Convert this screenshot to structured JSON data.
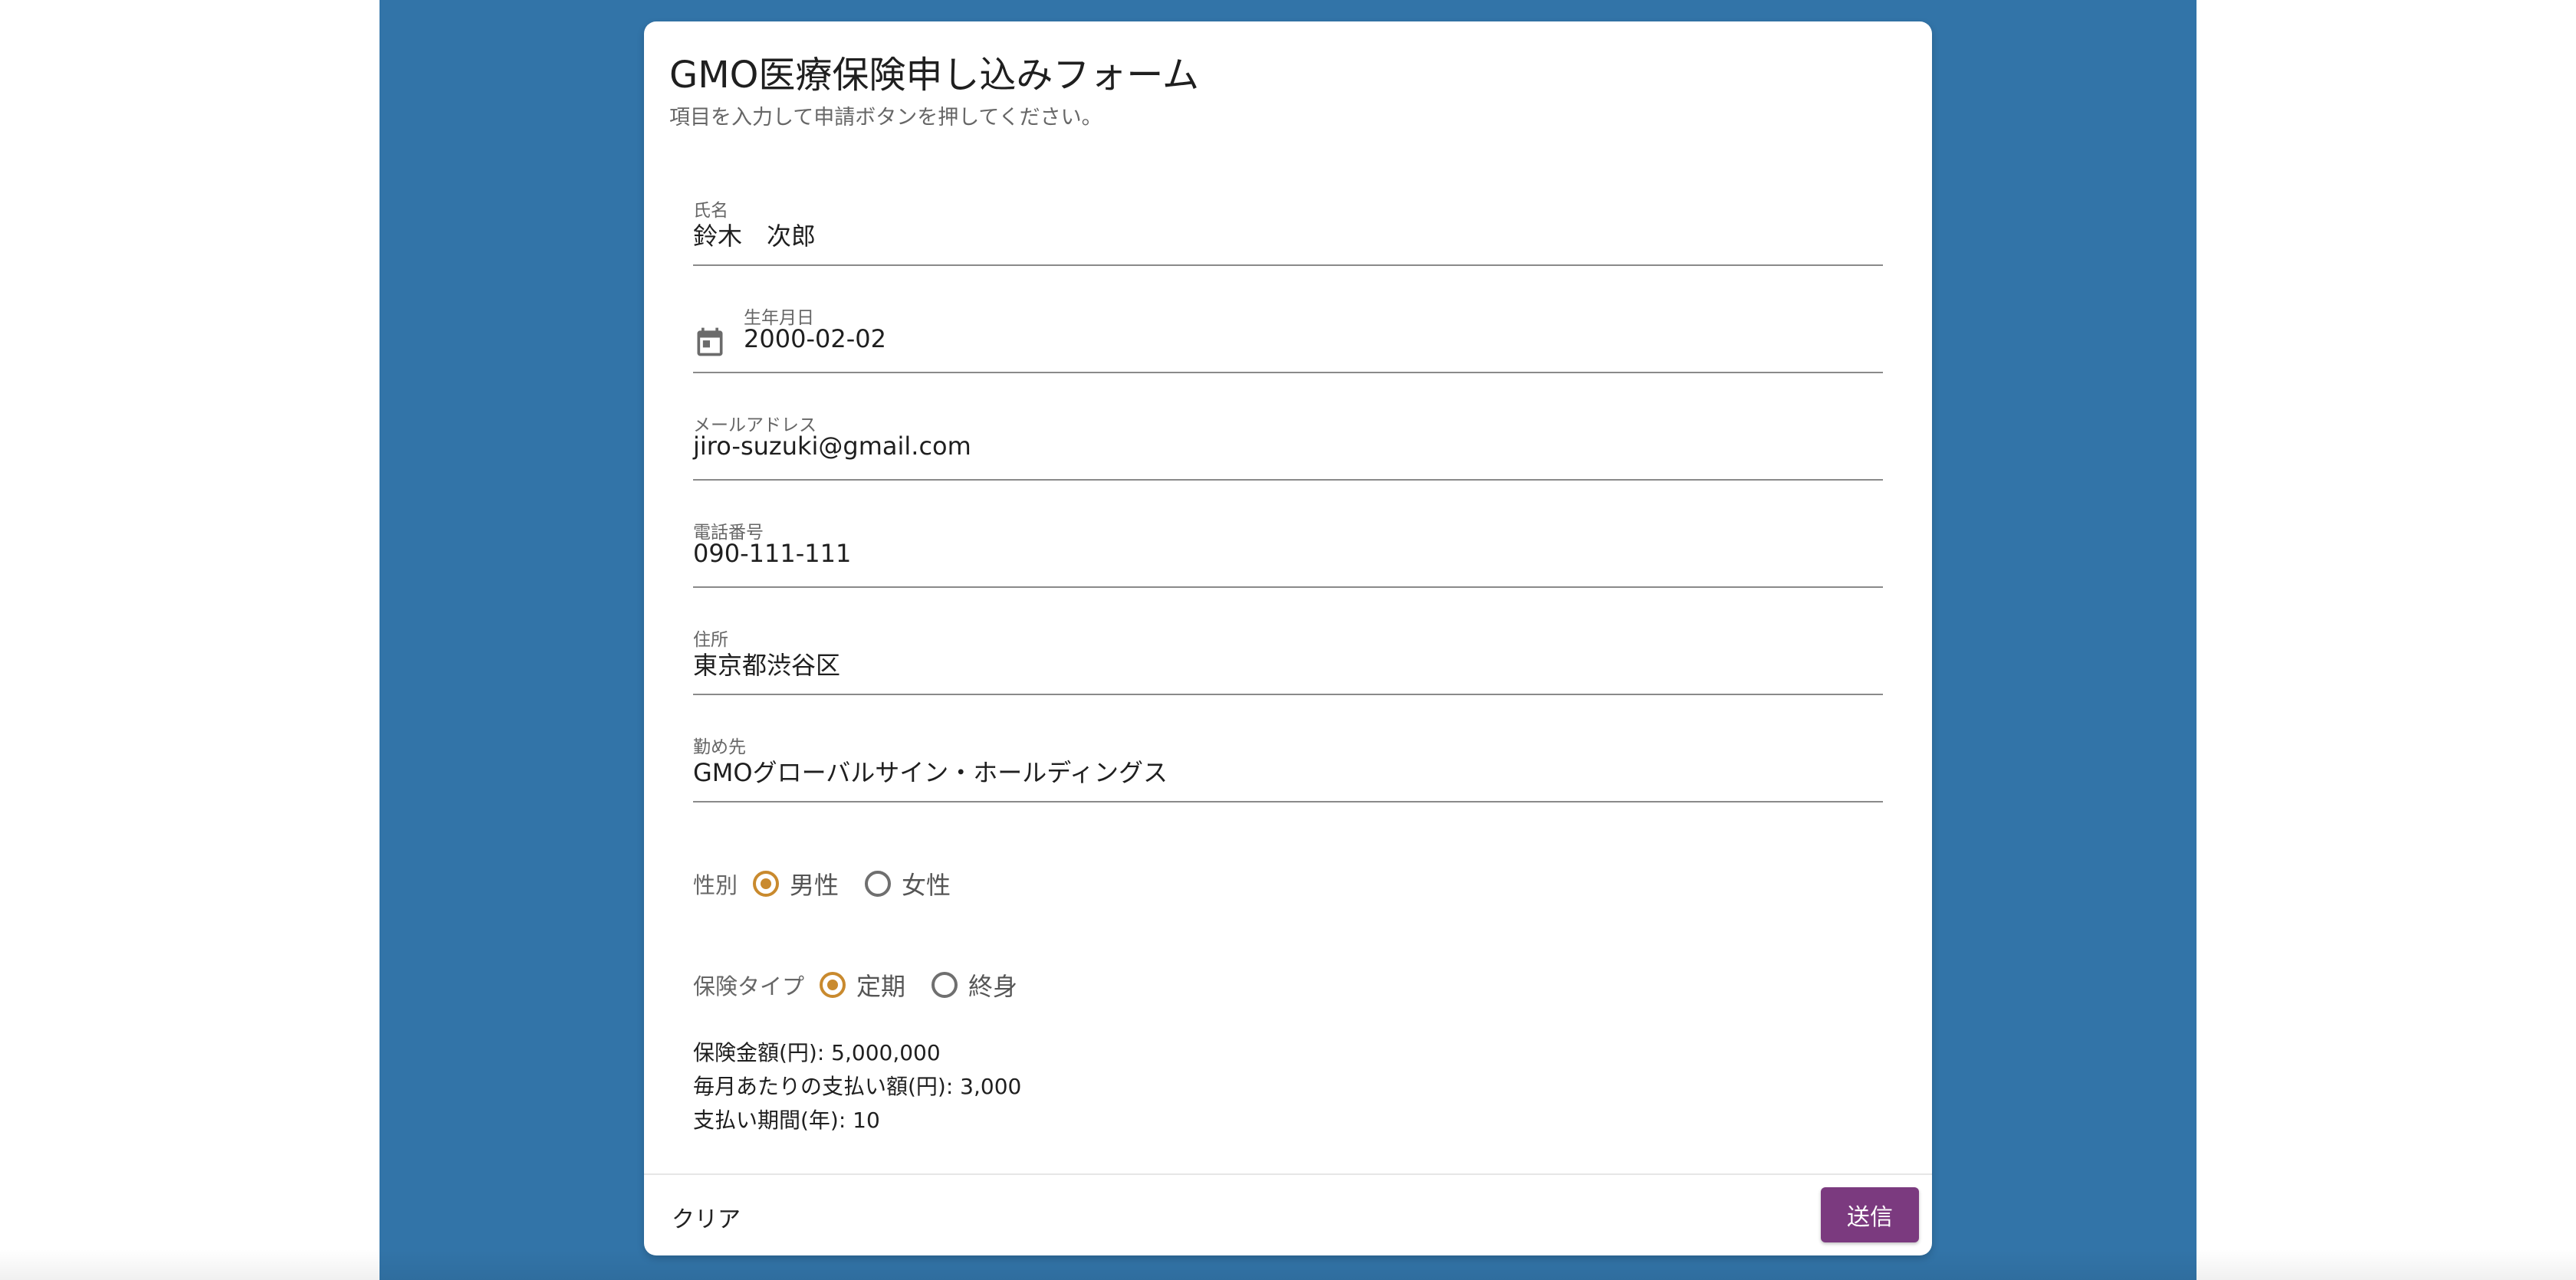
{
  "form": {
    "title": "GMO医療保険申し込みフォーム",
    "subtitle": "項目を入力して申請ボタンを押してください。"
  },
  "fields": {
    "name": {
      "label": "氏名",
      "value": "鈴木　次郎"
    },
    "birthdate": {
      "label": "生年月日",
      "value": "2000-02-02",
      "icon": "calendar-icon"
    },
    "email": {
      "label": "メールアドレス",
      "value": "jiro-suzuki@gmail.com"
    },
    "phone": {
      "label": "電話番号",
      "value": "090-111-111"
    },
    "address": {
      "label": "住所",
      "value": "東京都渋谷区"
    },
    "employer": {
      "label": "勤め先",
      "value": "GMOグローバルサイン・ホールディングス"
    }
  },
  "gender": {
    "label": "性別",
    "options": [
      {
        "label": "男性",
        "checked": true
      },
      {
        "label": "女性",
        "checked": false
      }
    ]
  },
  "insurance_type": {
    "label": "保険タイプ",
    "options": [
      {
        "label": "定期",
        "checked": true
      },
      {
        "label": "終身",
        "checked": false
      }
    ]
  },
  "summary": {
    "amount": "保険金額(円): 5,000,000",
    "monthly_payment": "毎月あたりの支払い額(円): 3,000",
    "period": "支払い期間(年): 10"
  },
  "actions": {
    "clear_label": "クリア",
    "submit_label": "送信"
  },
  "colors": {
    "background_band": "#3274a8",
    "radio_accent": "#c98a2e",
    "submit_button": "#7b3a7f"
  }
}
